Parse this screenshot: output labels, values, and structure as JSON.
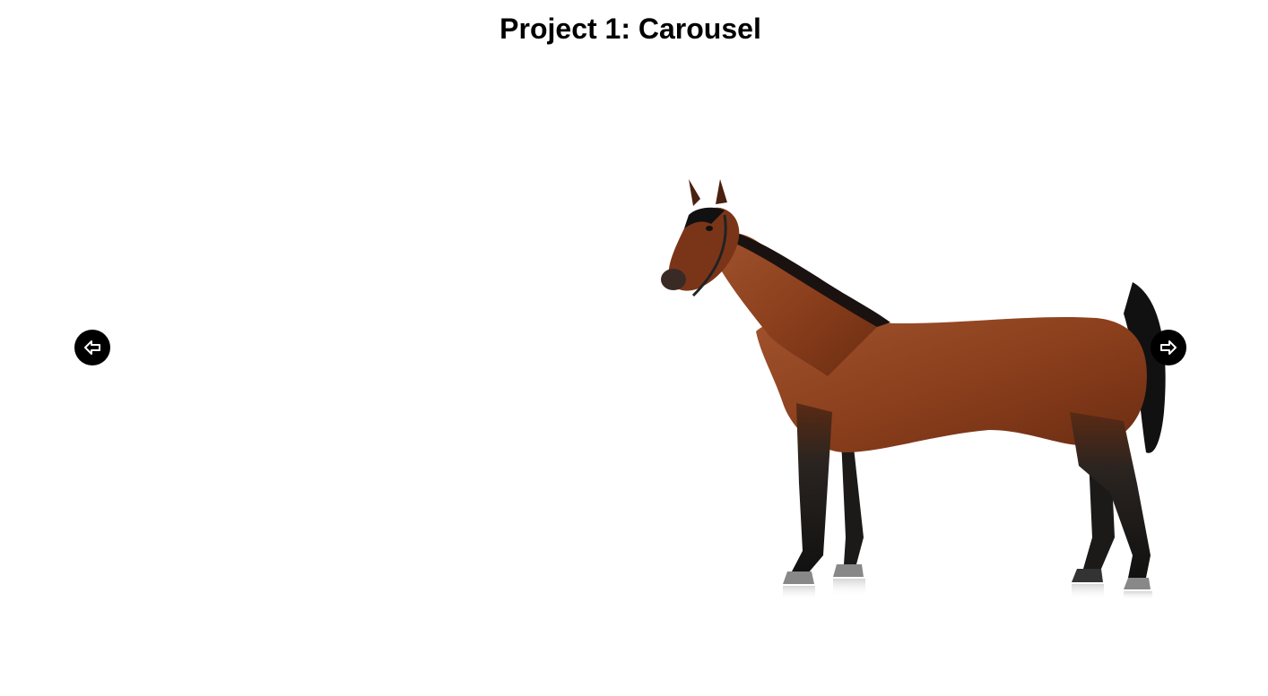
{
  "page": {
    "title": "Project 1: Carousel"
  },
  "carousel": {
    "current_slide": {
      "subject": "bay horse standing in profile on white background"
    },
    "prev_button": {
      "icon": "arrow-left-circle-icon"
    },
    "next_button": {
      "icon": "arrow-right-circle-icon"
    }
  },
  "colors": {
    "background": "#ffffff",
    "button_bg": "#000000",
    "button_icon": "#ffffff",
    "horse_coat": "#8b3f1c",
    "horse_points": "#1a1a1a"
  }
}
